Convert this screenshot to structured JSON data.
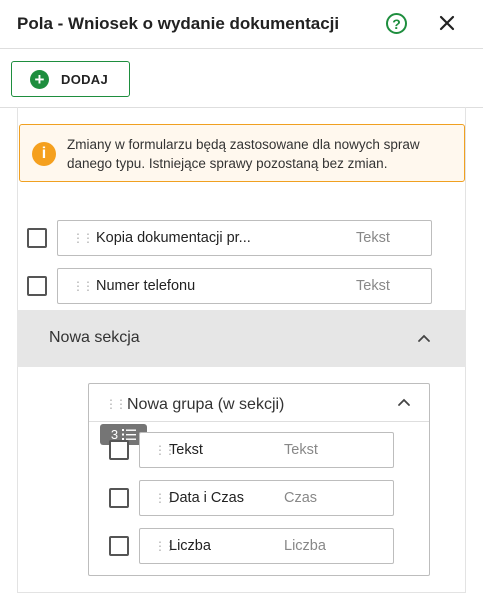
{
  "header": {
    "title": "Pola - Wniosek o wydanie dokumentacji",
    "help_icon": "help-circle-icon",
    "close_icon": "close-icon"
  },
  "toolbar": {
    "add_label": "DODAJ",
    "add_icon": "plus-circle-icon"
  },
  "info": {
    "icon": "info-icon",
    "text": "Zmiany w formularzu będą zastosowane dla nowych spraw danego typu. Istniejące sprawy pozostaną bez zmian."
  },
  "fields": [
    {
      "name": "Kopia dokumentacji pr...",
      "type": "Tekst"
    },
    {
      "name": "Numer telefonu",
      "type": "Tekst"
    }
  ],
  "section": {
    "title": "Nowa sekcja",
    "group": {
      "title": "Nowa grupa (w sekcji)",
      "badge_count": "3",
      "fields": [
        {
          "name": "Tekst",
          "type": "Tekst"
        },
        {
          "name": "Data i Czas",
          "type": "Czas"
        },
        {
          "name": "Liczba",
          "type": "Liczba"
        }
      ]
    }
  },
  "colors": {
    "accent": "#1e8e3e",
    "warning": "#f5a01e",
    "section_bg": "#e6e6e6"
  }
}
